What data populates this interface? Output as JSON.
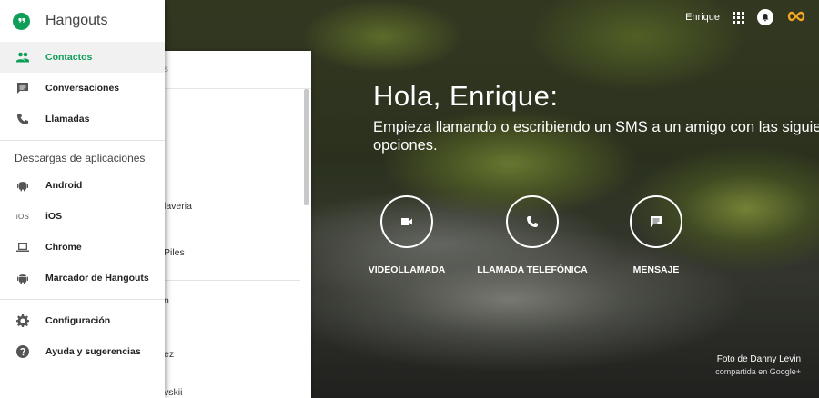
{
  "topbar": {
    "user_name": "Enrique",
    "apps_icon": "apps-grid-icon",
    "notifications_icon": "notifications-icon",
    "brand_icon": "infinity-icon"
  },
  "drawer": {
    "title": "Hangouts",
    "items": [
      {
        "label": "Contactos",
        "icon": "people-icon",
        "active": true
      },
      {
        "label": "Conversaciones",
        "icon": "chat-icon"
      },
      {
        "label": "Llamadas",
        "icon": "phone-icon"
      }
    ],
    "downloads_heading": "Descargas de aplicaciones",
    "downloads": [
      {
        "label": "Android",
        "icon": "android-icon"
      },
      {
        "label": "iOS",
        "icon": "ios-icon",
        "icon_text": "iOS"
      },
      {
        "label": "Chrome",
        "icon": "laptop-icon"
      },
      {
        "label": "Marcador de Hangouts",
        "icon": "android-icon"
      }
    ],
    "footer": [
      {
        "label": "Configuración",
        "icon": "gear-icon"
      },
      {
        "label": "Ayuda y sugerencias",
        "icon": "help-icon"
      }
    ]
  },
  "contacts_panel": {
    "search_fragment": "s",
    "fragments": [
      "laveria",
      "Piles",
      "n",
      "ez",
      "vskii"
    ]
  },
  "hero": {
    "greeting": "Hola, Enrique:",
    "subtitle": "Empieza llamando o escribiendo un SMS a un amigo con las siguientes opciones."
  },
  "actions": [
    {
      "label": "VIDEOLLAMADA",
      "icon": "videocam-icon"
    },
    {
      "label": "LLAMADA TELEFÓNICA",
      "icon": "phone-icon"
    },
    {
      "label": "MENSAJE",
      "icon": "message-icon"
    }
  ],
  "credit": {
    "line1": "Foto de Danny Levin",
    "line2": "compartida en Google+"
  }
}
